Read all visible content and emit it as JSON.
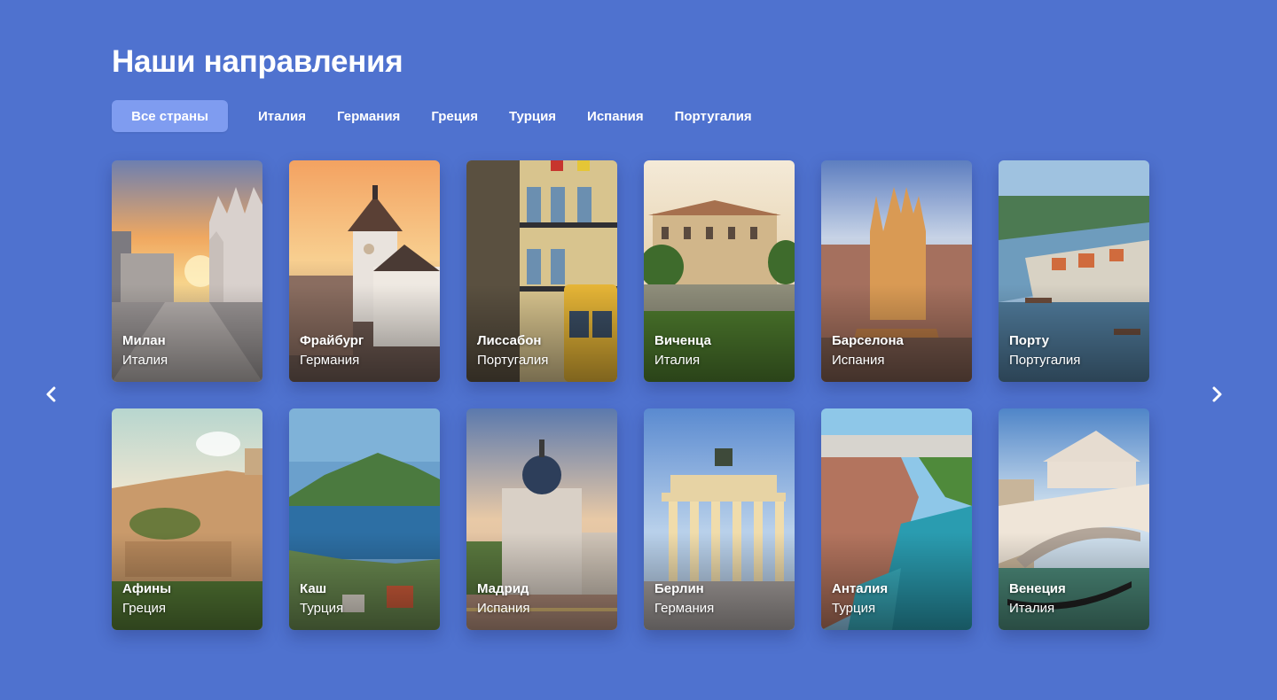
{
  "header": {
    "title": "Наши направления"
  },
  "tabs": [
    {
      "label": "Все страны",
      "active": true
    },
    {
      "label": "Италия"
    },
    {
      "label": "Германия"
    },
    {
      "label": "Греция"
    },
    {
      "label": "Турция"
    },
    {
      "label": "Испания"
    },
    {
      "label": "Португалия"
    }
  ],
  "destinations": [
    {
      "city": "Милан",
      "country": "Италия"
    },
    {
      "city": "Фрайбург",
      "country": "Германия"
    },
    {
      "city": "Лиссабон",
      "country": "Португалия"
    },
    {
      "city": "Виченца",
      "country": "Италия"
    },
    {
      "city": "Барселона",
      "country": "Испания"
    },
    {
      "city": "Порту",
      "country": "Португалия"
    },
    {
      "city": "Афины",
      "country": "Греция"
    },
    {
      "city": "Каш",
      "country": "Турция"
    },
    {
      "city": "Мадрид",
      "country": "Испания"
    },
    {
      "city": "Берлин",
      "country": "Германия"
    },
    {
      "city": "Анталия",
      "country": "Турция"
    },
    {
      "city": "Венеция",
      "country": "Италия"
    }
  ],
  "navigation": {
    "prev_icon": "chevron-left-icon",
    "next_icon": "chevron-right-icon"
  },
  "colors": {
    "background": "#4f72cf",
    "active_tab": "#7f9cf0",
    "text": "#ffffff"
  }
}
